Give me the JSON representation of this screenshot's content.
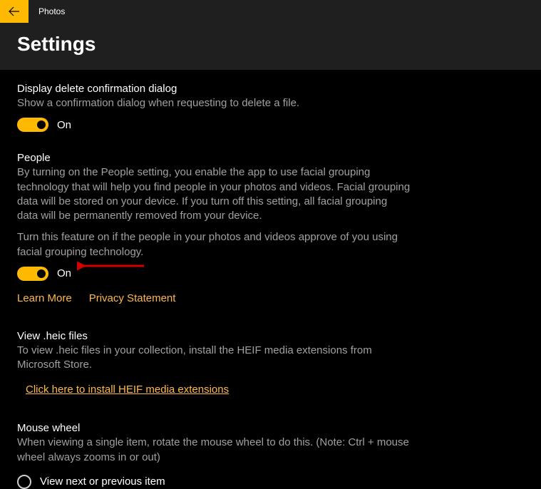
{
  "titlebar": {
    "app_name": "Photos"
  },
  "header": {
    "page_title": "Settings"
  },
  "settings": {
    "delete_confirm": {
      "label": "Display delete confirmation dialog",
      "desc": "Show a confirmation dialog when requesting to delete a file.",
      "state_label": "On",
      "on": true
    },
    "people": {
      "label": "People",
      "desc1": "By turning on the People setting, you enable the app to use facial grouping technology that will help you find people in your photos and videos. Facial grouping data will be stored on your device. If you turn off this setting, all facial grouping data will be permanently removed from your device.",
      "desc2": "Turn this feature on if the people in your photos and videos approve of you using facial grouping technology.",
      "state_label": "On",
      "on": true,
      "learn_more": "Learn More",
      "privacy": "Privacy Statement"
    },
    "heic": {
      "label": "View .heic files",
      "desc": "To view .heic files in your collection, install the HEIF media extensions from Microsoft Store.",
      "link": "Click here to install HEIF media extensions"
    },
    "mouse_wheel": {
      "label": "Mouse wheel",
      "desc": "When viewing a single item, rotate the mouse wheel to do this. (Note: Ctrl + mouse wheel always zooms in or out)",
      "option1": "View next or previous item"
    }
  }
}
